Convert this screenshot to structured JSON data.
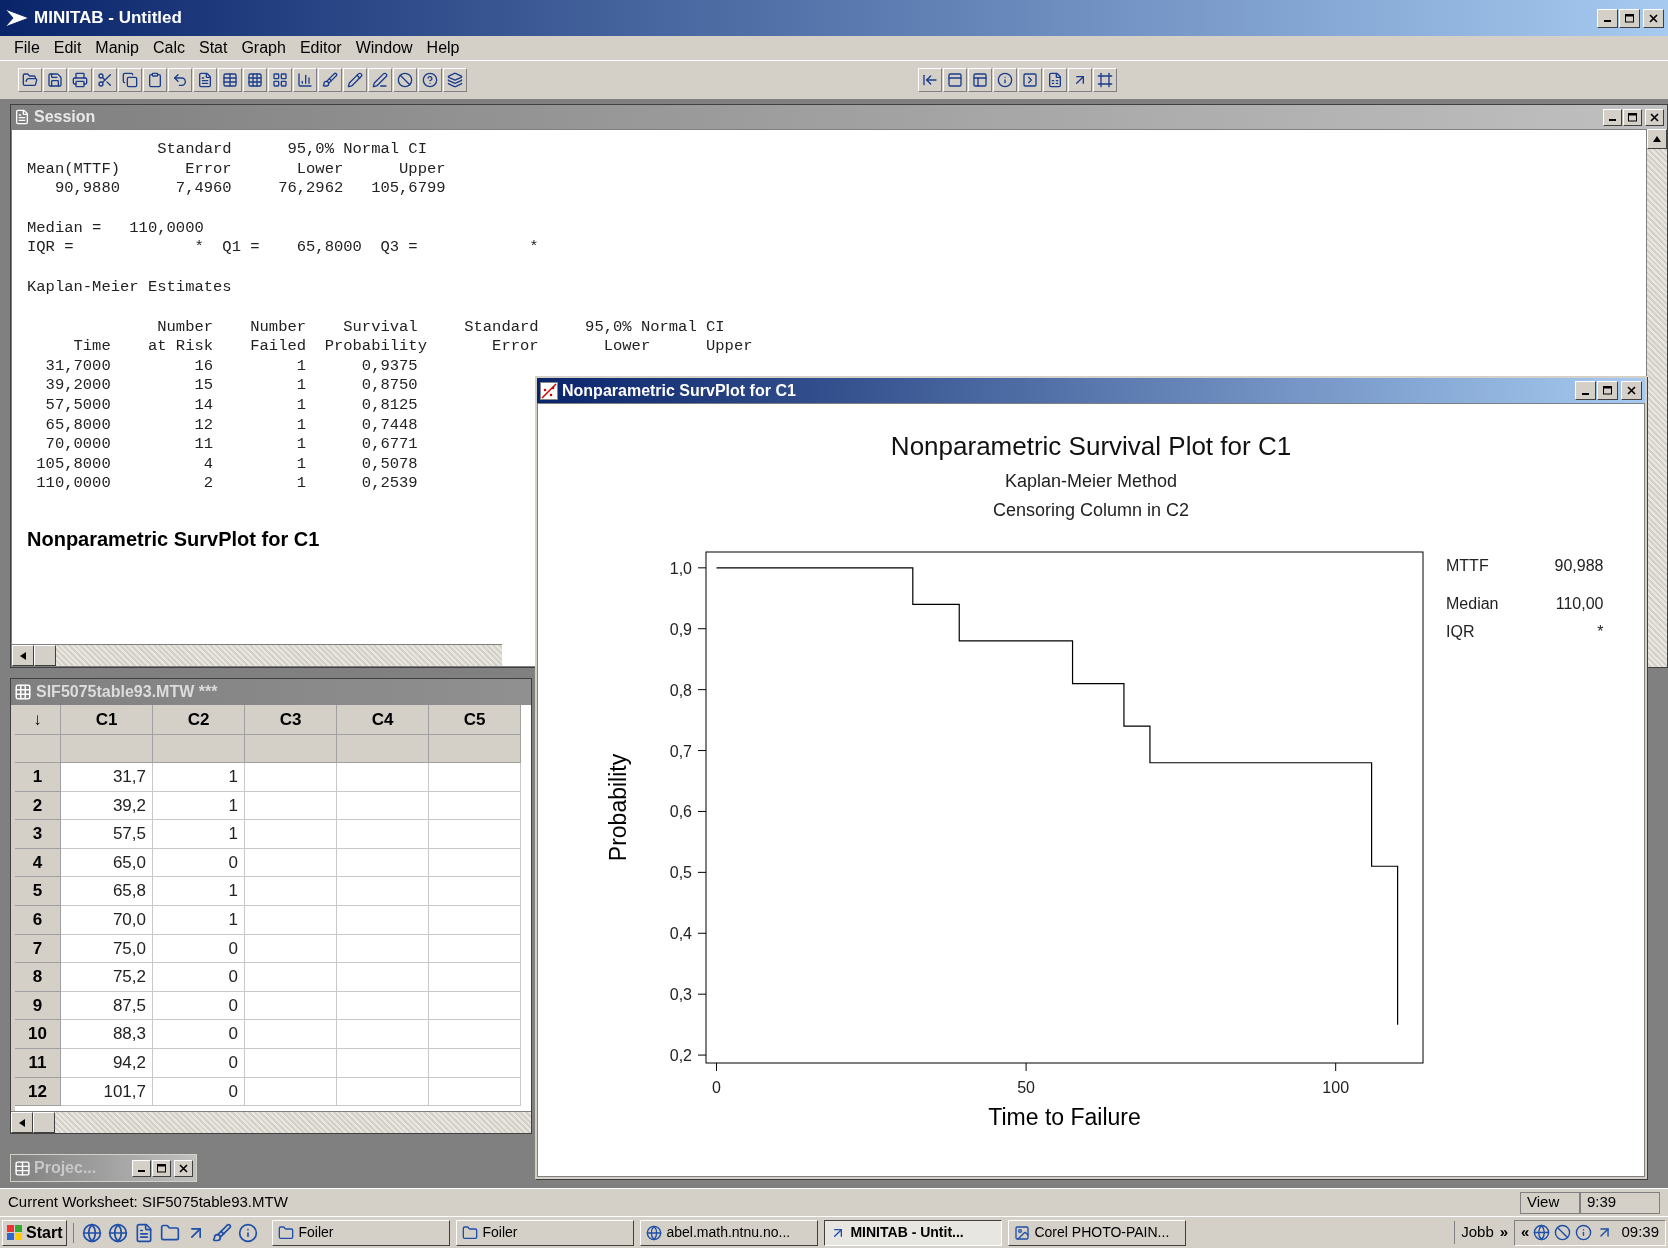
{
  "window": {
    "title": "MINITAB - Untitled"
  },
  "menu": [
    {
      "label": "File"
    },
    {
      "label": "Edit"
    },
    {
      "label": "Manip"
    },
    {
      "label": "Calc"
    },
    {
      "label": "Stat"
    },
    {
      "label": "Graph"
    },
    {
      "label": "Editor"
    },
    {
      "label": "Window"
    },
    {
      "label": "Help"
    }
  ],
  "session": {
    "title": "Session",
    "blocks": [
      [
        "              Standard      95,0% Normal CI",
        "Mean(MTTF)       Error       Lower      Upper",
        "   90,9880      7,4960     76,2962   105,6799"
      ],
      [
        "Median =   110,0000",
        "IQR =             *  Q1 =    65,8000  Q3 =            *"
      ],
      [
        "Kaplan-Meier Estimates"
      ],
      [
        "              Number    Number    Survival     Standard     95,0% Normal CI",
        "     Time    at Risk    Failed  Probability       Error       Lower      Upper",
        "  31,7000         16         1      0,9375",
        "  39,2000         15         1      0,8750",
        "  57,5000         14         1      0,8125",
        "  65,8000         12         1      0,7448",
        "  70,0000         11         1      0,6771",
        " 105,8000          4         1      0,5078",
        " 110,0000          2         1      0,2539"
      ]
    ],
    "heading": "Nonparametric SurvPlot for C1"
  },
  "worksheet": {
    "title": "SIF5075table93.MTW ***",
    "corner": "↓",
    "columns": [
      "C1",
      "C2",
      "C3",
      "C4",
      "C5"
    ],
    "rows": [
      {
        "index": "1",
        "cells": [
          "31,7",
          "1"
        ]
      },
      {
        "index": "2",
        "cells": [
          "39,2",
          "1"
        ]
      },
      {
        "index": "3",
        "cells": [
          "57,5",
          "1"
        ]
      },
      {
        "index": "4",
        "cells": [
          "65,0",
          "0"
        ]
      },
      {
        "index": "5",
        "cells": [
          "65,8",
          "1"
        ]
      },
      {
        "index": "6",
        "cells": [
          "70,0",
          "1"
        ]
      },
      {
        "index": "7",
        "cells": [
          "75,0",
          "0"
        ]
      },
      {
        "index": "8",
        "cells": [
          "75,2",
          "0"
        ]
      },
      {
        "index": "9",
        "cells": [
          "87,5",
          "0"
        ]
      },
      {
        "index": "10",
        "cells": [
          "88,3",
          "0"
        ]
      },
      {
        "index": "11",
        "cells": [
          "94,2",
          "0"
        ]
      },
      {
        "index": "12",
        "cells": [
          "101,7",
          "0"
        ]
      }
    ]
  },
  "project": {
    "title": "Projec..."
  },
  "graph": {
    "title": "Nonparametric SurvPlot for C1",
    "subtitles": [
      "Kaplan-Meier Method",
      "Censoring Column in C2"
    ],
    "chart_data": {
      "type": "line",
      "title": "Nonparametric Survival Plot for C1",
      "xlabel": "Time to Failure",
      "ylabel": "Probability",
      "x": [
        0,
        31.7,
        31.7,
        39.2,
        39.2,
        57.5,
        57.5,
        65.8,
        65.8,
        70,
        70,
        105.8,
        105.8,
        110,
        110
      ],
      "series": [
        {
          "color": "#000000",
          "values": [
            1,
            1,
            0.94,
            0.94,
            0.88,
            0.88,
            0.81,
            0.81,
            0.74,
            0.74,
            0.68,
            0.68,
            0.51,
            0.51,
            0.25
          ]
        }
      ],
      "xlim": [
        -1.7,
        114.1
      ],
      "ylim": [
        0.187,
        1.026
      ],
      "xticks": [
        0,
        50,
        100
      ],
      "yticks": [
        {
          "value": 1,
          "label": "1,0"
        },
        {
          "value": 0.9,
          "label": "0,9"
        },
        {
          "value": 0.8,
          "label": "0,8"
        },
        {
          "value": 0.7,
          "label": "0,7"
        },
        {
          "value": 0.6,
          "label": "0,6"
        },
        {
          "value": 0.5,
          "label": "0,5"
        },
        {
          "value": 0.4,
          "label": "0,4"
        },
        {
          "value": 0.3,
          "label": "0,3"
        },
        {
          "value": 0.2,
          "label": "0,2"
        }
      ]
    },
    "stats": [
      {
        "label": "MTTF",
        "value": "90,988"
      },
      {
        "label": "Median",
        "value": "110,00"
      },
      {
        "label": "IQR",
        "value": "*"
      }
    ]
  },
  "status_bar": {
    "text": "Current Worksheet: SIF5075table93.MTW",
    "view": "View",
    "time": "9:39"
  },
  "taskbar": {
    "start": "Start",
    "tasks": [
      {
        "kind": "folder",
        "label": "Foiler",
        "selected": false
      },
      {
        "kind": "folder",
        "label": "Foiler",
        "selected": false
      },
      {
        "kind": "browser",
        "label": "abel.math.ntnu.no...",
        "selected": false
      },
      {
        "kind": "minitab",
        "label": "MINITAB - Untit...",
        "selected": true
      },
      {
        "kind": "paint",
        "label": "Corel PHOTO-PAIN...",
        "selected": false
      }
    ],
    "toolbar_label": "Jobb",
    "more": "»",
    "collapse": "«",
    "clock": "09:39"
  }
}
